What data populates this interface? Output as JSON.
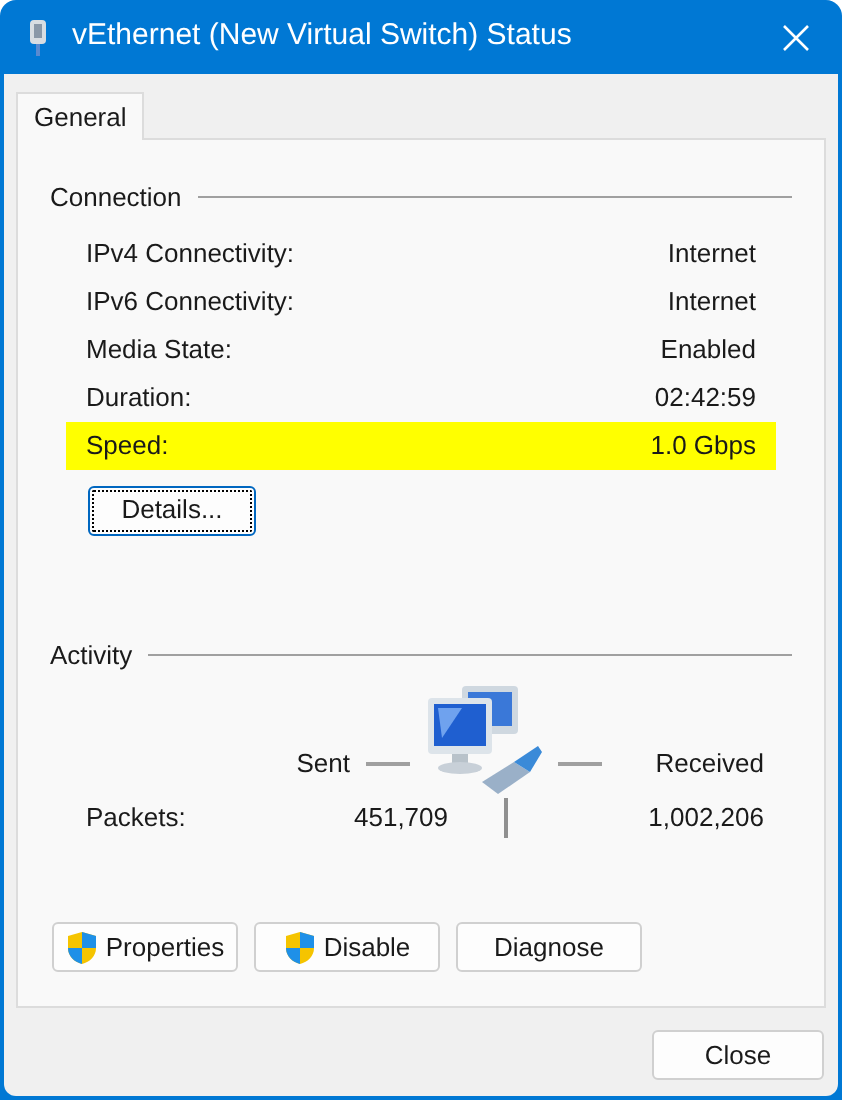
{
  "window": {
    "title": "vEthernet (New Virtual Switch) Status"
  },
  "tabs": [
    {
      "label": "General",
      "selected": true
    }
  ],
  "connection": {
    "title": "Connection",
    "rows": [
      {
        "label": "IPv4 Connectivity:",
        "value": "Internet",
        "highlighted": false
      },
      {
        "label": "IPv6 Connectivity:",
        "value": "Internet",
        "highlighted": false
      },
      {
        "label": "Media State:",
        "value": "Enabled",
        "highlighted": false
      },
      {
        "label": "Duration:",
        "value": "02:42:59",
        "highlighted": false
      },
      {
        "label": "Speed:",
        "value": "1.0 Gbps",
        "highlighted": true
      }
    ],
    "details_button": {
      "label": "Details...",
      "focused": true
    }
  },
  "activity": {
    "title": "Activity",
    "sent_label": "Sent",
    "received_label": "Received",
    "packets_label": "Packets:",
    "packets_sent": "451,709",
    "packets_received": "1,002,206"
  },
  "buttons": [
    {
      "label": "Properties",
      "shield": true
    },
    {
      "label": "Disable",
      "shield": true
    },
    {
      "label": "Diagnose",
      "shield": false
    }
  ],
  "footer": {
    "close_button": "Close"
  }
}
